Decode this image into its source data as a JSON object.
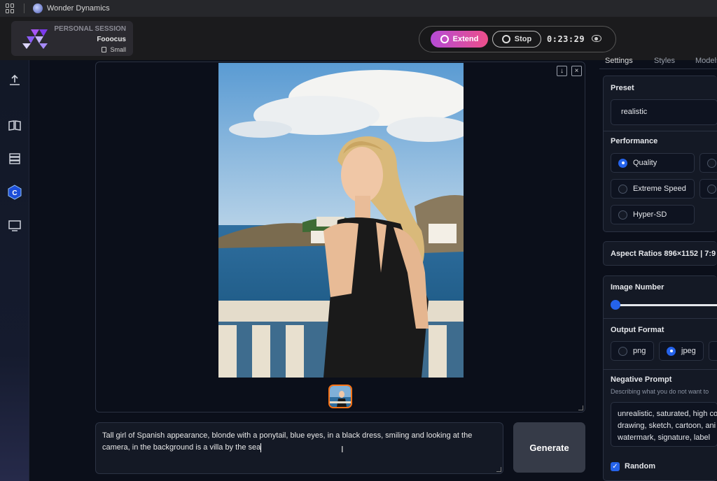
{
  "titlebar": {
    "app_title": "Wonder Dynamics"
  },
  "session": {
    "label": "PERSONAL SESSION",
    "name": "Fooocus",
    "size": "Small"
  },
  "controls": {
    "extend_label": "Extend",
    "stop_label": "Stop",
    "timer": "0:23:29"
  },
  "gallery": {
    "download_icon": "↓",
    "close_icon": "×"
  },
  "prompt": {
    "text": "Tall girl of Spanish appearance, blonde with a ponytail, blue eyes, in a black dress, smiling and looking at the camera, in the background is a villa by the sea"
  },
  "generate_label": "Generate",
  "tabs": [
    "Settings",
    "Styles",
    "Models"
  ],
  "settings": {
    "preset_title": "Preset",
    "preset_value": "realistic",
    "performance_title": "Performance",
    "performance_options": [
      "Quality",
      "Extreme Speed",
      "Hyper-SD"
    ],
    "performance_selected": "Quality",
    "aspect_ratios": "Aspect Ratios 896×1152 | 7:9",
    "image_number_title": "Image Number",
    "output_format_title": "Output Format",
    "output_formats": [
      "png",
      "jpeg"
    ],
    "output_selected": "jpeg",
    "negative_prompt_title": "Negative Prompt",
    "negative_prompt_hint": "Describing what you do not want to",
    "negative_prompt_lines": [
      "unrealistic, saturated, high co",
      "drawing, sketch, cartoon, ani",
      "watermark, signature, label"
    ],
    "random_label": "Random"
  },
  "colors": {
    "accent": "#2563eb",
    "extend_gradient_start": "#b54bd6",
    "extend_gradient_end": "#ec4f8a",
    "thumb_border": "#f97316"
  },
  "icons": {
    "rail": [
      "upload-icon",
      "book-icon",
      "layers-icon",
      "c-badge-icon",
      "monitor-icon"
    ]
  }
}
